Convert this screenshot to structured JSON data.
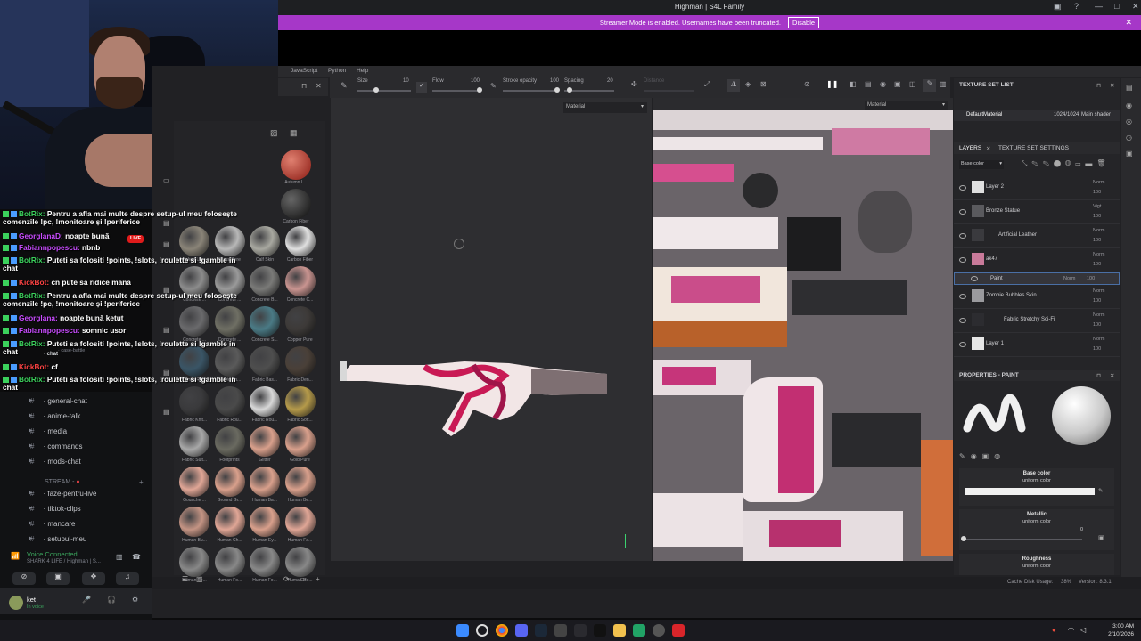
{
  "window": {
    "title": "Highman | S4L Family"
  },
  "streamer_banner": {
    "text": "Streamer Mode is enabled. Usernames have been truncated.",
    "button": "Disable"
  },
  "chat": [
    {
      "user": "BotRix:",
      "text": "Pentru a afla mai multe despre setup-ul meu folosește comenzile !pc, !monitoare și !periferice",
      "color": "green"
    },
    {
      "user": "GeorglanaD:",
      "text": "noapte bună",
      "color": "purple"
    },
    {
      "user": "Fabiannpopescu:",
      "text": "nbnb",
      "color": "purple"
    },
    {
      "user": "BotRix:",
      "text": "Puteti sa folositi !points, !slots, !roulette si !gamble in chat",
      "color": "green"
    },
    {
      "user": "KickBot:",
      "text": "cn pute sa ridice mana",
      "color": "red"
    },
    {
      "user": "BotRix:",
      "text": "Pentru a afla mai multe despre setup-ul meu folosește comenzile !pc, !monitoare și !periferice",
      "color": "green"
    },
    {
      "user": "Georglana:",
      "text": "noapte bună ketut",
      "color": "purple"
    },
    {
      "user": "Fabiannpopescu:",
      "text": "somnic usor",
      "color": "purple"
    },
    {
      "user": "BotRix:",
      "text": "Puteti sa folositi !points, !slots, !roulette si !gamble in chat",
      "color": "green"
    },
    {
      "user": "KickBot:",
      "text": "cf",
      "color": "red"
    },
    {
      "user": "BotRix:",
      "text": "Puteti sa folositi !points, !slots, !roulette si !gamble in chat",
      "color": "green"
    }
  ],
  "live_badge": "LIVE",
  "discord": {
    "channels": [
      "general-chat",
      "anime-talk",
      "media",
      "commands",
      "mods-chat"
    ],
    "partial_channels": [
      "case-battle",
      "chat"
    ],
    "stream_category": "STREAM -",
    "stream_channels": [
      "faze-pentru-live",
      "tiktok-clips",
      "mancare",
      "setupul-meu"
    ],
    "voice": {
      "status": "Voice Connected",
      "server": "SHARK 4 LIFE / Highman | S..."
    },
    "user": {
      "name": "ket",
      "status": "In voice"
    }
  },
  "painter": {
    "menu": [
      "JavaScript",
      "Python",
      "Help"
    ],
    "toolbar": {
      "size_label": "Size",
      "size_value": "10",
      "flow_label": "Flow",
      "flow_value": "100",
      "opacity_label": "Stroke opacity",
      "opacity_value": "100",
      "spacing_label": "Spacing",
      "spacing_value": "20",
      "distance_label": "Distance"
    },
    "viewport_material": "Material",
    "uv_material": "Material",
    "shelf_items": [
      [
        "Autumn L..."
      ],
      [
        "Carbon Fiber"
      ],
      [
        "Baked Lig...",
        "Brass Pure",
        "Calf Skin",
        "Carbon Fiber"
      ],
      [
        "Concrete ...",
        "Concrete ...",
        "Concrete B...",
        "Concrete C..."
      ],
      [
        "Concrete ...",
        "Concrete ...",
        "Concrete S...",
        "Copper Pure"
      ],
      [
        "Denim Rivet",
        "Fabric Ba...",
        "Fabric Bas...",
        "Fabric Den..."
      ],
      [
        "Fabric Knit...",
        "Fabric Rou...",
        "Fabric Rou...",
        "Fabric Soft..."
      ],
      [
        "Fabric Suit...",
        "Footprints",
        "Glitter",
        "Gold Pure"
      ],
      [
        "Gouache ...",
        "Ground Gr...",
        "Human Ba...",
        "Human Be..."
      ],
      [
        "Human Bu...",
        "Human Ch...",
        "Human Ey...",
        "Human Fa..."
      ],
      [
        "Human Fe...",
        "Human Fo...",
        "Human Fo...",
        "Human He..."
      ]
    ],
    "texture_set_list": {
      "title": "TEXTURE SET LIST",
      "material": "DefaultMaterial",
      "resolution": "1024/1024",
      "shader": "Main shader"
    },
    "tabs": {
      "layers": "LAYERS",
      "settings": "TEXTURE SET SETTINGS"
    },
    "channel": "Base color",
    "layers": [
      {
        "name": "Layer 2",
        "blend": "Norm",
        "opacity": "100"
      },
      {
        "name": "Bronze Statue",
        "blend": "Norm",
        "opacity": "100"
      },
      {
        "name": "Artificial Leather",
        "blend": "Norm",
        "opacity": "100"
      },
      {
        "name": "ak47",
        "blend": "Norm",
        "opacity": "100"
      },
      {
        "name": "Paint",
        "blend": "Norm",
        "opacity": "100"
      },
      {
        "name": "Zombie Bubbles Skin",
        "blend": "Norm",
        "opacity": "100"
      },
      {
        "name": "Fabric Stretchy Sci-Fi",
        "blend": "Norm",
        "opacity": "100"
      },
      {
        "name": "Layer 1",
        "blend": "Norm",
        "opacity": "100"
      }
    ],
    "folder_blend": "Vigt",
    "properties": {
      "title": "PROPERTIES - PAINT",
      "base_color": "Base color",
      "base_color_sub": "uniform color",
      "metallic": "Metallic",
      "metallic_sub": "uniform color",
      "metallic_value": "0",
      "roughness": "Roughness",
      "roughness_sub": "uniform color"
    },
    "status": {
      "cache": "Cache Disk Usage:",
      "cache_value": "38%",
      "version": "Version: 8.3.1"
    }
  },
  "taskbar": {
    "time": "3:00 AM",
    "date": "2/10/2026"
  }
}
